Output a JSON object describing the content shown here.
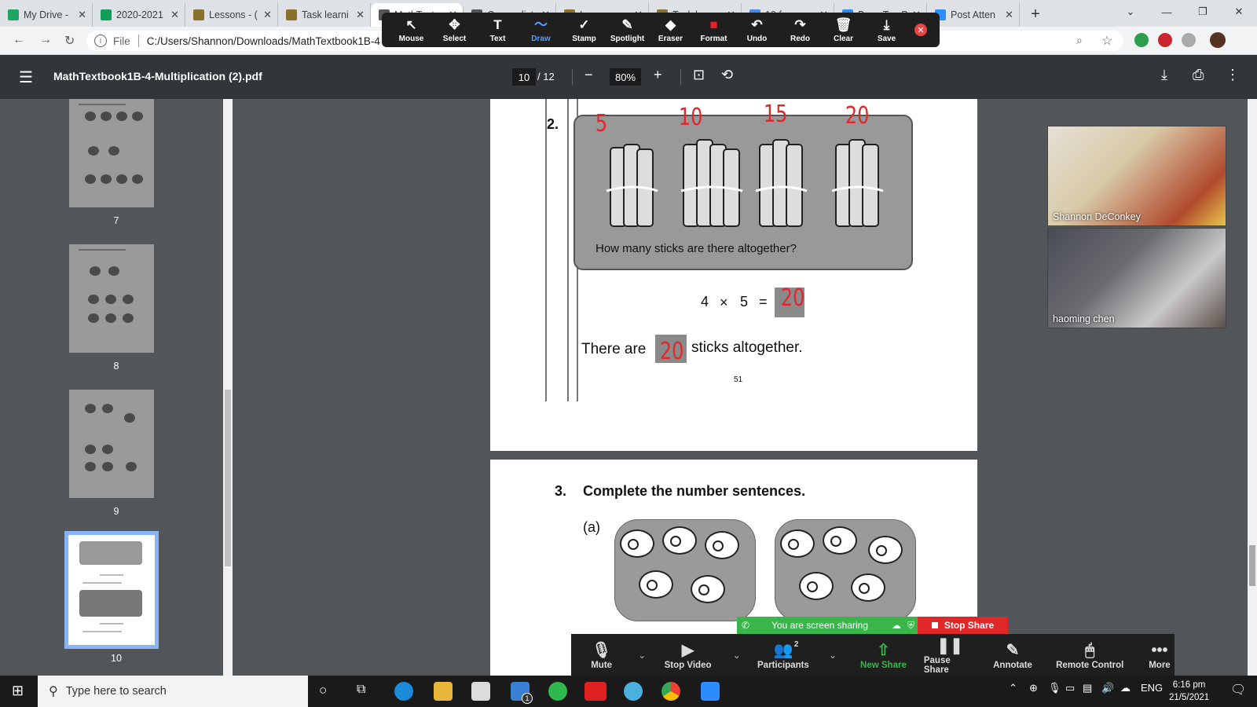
{
  "browser": {
    "tabs": [
      {
        "label": "My Drive -",
        "color": "#1fa463"
      },
      {
        "label": "2020-2021",
        "color": "#0f9d58"
      },
      {
        "label": "Lessons - (",
        "color": "#8a6f2e"
      },
      {
        "label": "Task learni",
        "color": "#8a6f2e"
      },
      {
        "label": "MathText",
        "color": "#555555"
      },
      {
        "label": "Course list",
        "color": "#555555"
      },
      {
        "label": "Lessons",
        "color": "#8a6f2e"
      },
      {
        "label": "Task learn",
        "color": "#8a6f2e"
      },
      {
        "label": "10 frame",
        "color": "#4285f4"
      },
      {
        "label": "Base Ten B",
        "color": "#2d8cff"
      },
      {
        "label": "Post Atten",
        "color": "#2d8cff"
      }
    ],
    "new_tab": "+",
    "address_scheme": "File",
    "address": "C:/Users/Shannon/Downloads/MathTextbook1B-4"
  },
  "annotate_toolbar": {
    "tools": [
      {
        "label": "Mouse",
        "icon": "↖"
      },
      {
        "label": "Select",
        "icon": "✥"
      },
      {
        "label": "Text",
        "icon": "T"
      },
      {
        "label": "Draw",
        "icon": "〜"
      },
      {
        "label": "Stamp",
        "icon": "✓"
      },
      {
        "label": "Spotlight",
        "icon": "✎"
      },
      {
        "label": "Eraser",
        "icon": "◆"
      },
      {
        "label": "Format",
        "icon": "■"
      },
      {
        "label": "Undo",
        "icon": "↶"
      },
      {
        "label": "Redo",
        "icon": "↷"
      },
      {
        "label": "Clear",
        "icon": "🗑"
      },
      {
        "label": "Save",
        "icon": "⤓"
      }
    ],
    "active_tool": "Draw",
    "format_color": "#e52222"
  },
  "pdf": {
    "title": "MathTextbook1B-4-Multiplication (2).pdf",
    "current_page": "10",
    "total_pages": "/ 12",
    "zoom": "80%"
  },
  "thumbnails": [
    {
      "number": "7"
    },
    {
      "number": "8"
    },
    {
      "number": "9"
    },
    {
      "number": "10"
    }
  ],
  "page1": {
    "question_number": "2.",
    "question_text": "How many sticks are there altogether?",
    "handwritten_counts": [
      "5",
      "10",
      "15",
      "20"
    ],
    "equation_left": "4",
    "equation_times": "×",
    "equation_right": "5",
    "equation_equals": "=",
    "equation_answer": "20",
    "sentence_start": "There are",
    "sentence_answer": "20",
    "sentence_end": "sticks altogether.",
    "page_number": "51"
  },
  "page2": {
    "question_number": "3.",
    "question_text": "Complete the number sentences.",
    "part_label": "(a)"
  },
  "participants": [
    {
      "name": "Shannon DeConkey"
    },
    {
      "name": "haoming chen"
    }
  ],
  "share_status": {
    "text": "You are screen sharing",
    "stop_label": "Stop Share"
  },
  "zoom_controls": [
    {
      "label": "Mute",
      "icon": "🎙"
    },
    {
      "label": "Stop Video",
      "icon": "▶"
    },
    {
      "label": "Participants",
      "icon": "👥",
      "badge": "2"
    },
    {
      "label": "New Share",
      "icon": "⇧"
    },
    {
      "label": "Pause Share",
      "icon": "❚❚"
    },
    {
      "label": "Annotate",
      "icon": "✎"
    },
    {
      "label": "Remote Control",
      "icon": "🖱"
    },
    {
      "label": "More",
      "icon": "•••"
    }
  ],
  "taskbar": {
    "search_placeholder": "Type here to search",
    "language": "ENG",
    "time": "6:16 pm",
    "date": "21/5/2021",
    "mail_badge": "1"
  }
}
